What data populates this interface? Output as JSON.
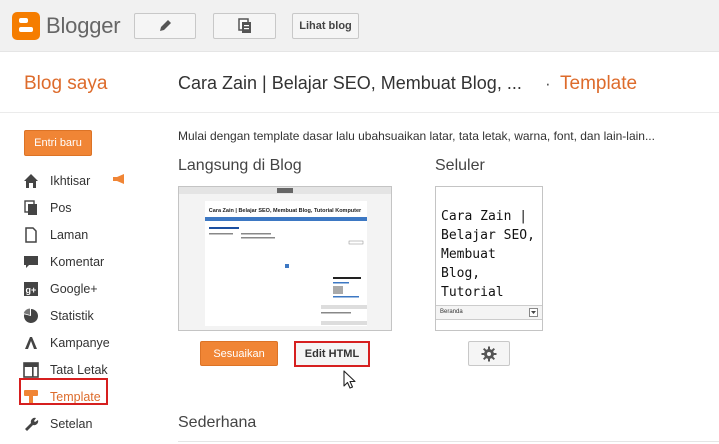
{
  "app": {
    "name": "Blogger"
  },
  "toolbar": {
    "view_blog_label": "Lihat blog"
  },
  "header": {
    "my_blogs": "Blog saya",
    "blog_title": "Cara Zain | Belajar SEO, Membuat Blog, ...",
    "separator": "·",
    "current_page": "Template"
  },
  "sidebar": {
    "new_post_label": "Entri baru",
    "items": [
      {
        "label": "Ikhtisar",
        "icon": "home-icon"
      },
      {
        "label": "Pos",
        "icon": "posts-icon"
      },
      {
        "label": "Laman",
        "icon": "page-icon"
      },
      {
        "label": "Komentar",
        "icon": "comment-icon"
      },
      {
        "label": "Google+",
        "icon": "google-plus-icon"
      },
      {
        "label": "Statistik",
        "icon": "stats-icon"
      },
      {
        "label": "Kampanye",
        "icon": "campaign-icon"
      },
      {
        "label": "Tata Letak",
        "icon": "layout-icon"
      },
      {
        "label": "Template",
        "icon": "template-icon",
        "active": true
      },
      {
        "label": "Setelan",
        "icon": "wrench-icon"
      }
    ]
  },
  "main": {
    "intro": "Mulai dengan template dasar lalu ubahsuaikan latar, tata letak, warna, font, dan lain-lain...",
    "live_heading": "Langsung di Blog",
    "mobile_heading": "Seluler",
    "live_preview": {
      "title": "Cara Zain | Belajar SEO, Membuat Blog, Tutorial Komputer"
    },
    "mobile_preview": {
      "title": "Cara Zain | Belajar SEO, Membuat Blog, Tutorial Komputer",
      "nav_label": "Beranda"
    },
    "customize_label": "Sesuaikan",
    "edit_html_label": "Edit HTML",
    "simple_heading": "Sederhana"
  },
  "colors": {
    "accent_orange": "#f08535",
    "link_orange": "#dd6b2b",
    "highlight_red": "#d61f1f",
    "topbar_bg": "#f1f1f1"
  }
}
